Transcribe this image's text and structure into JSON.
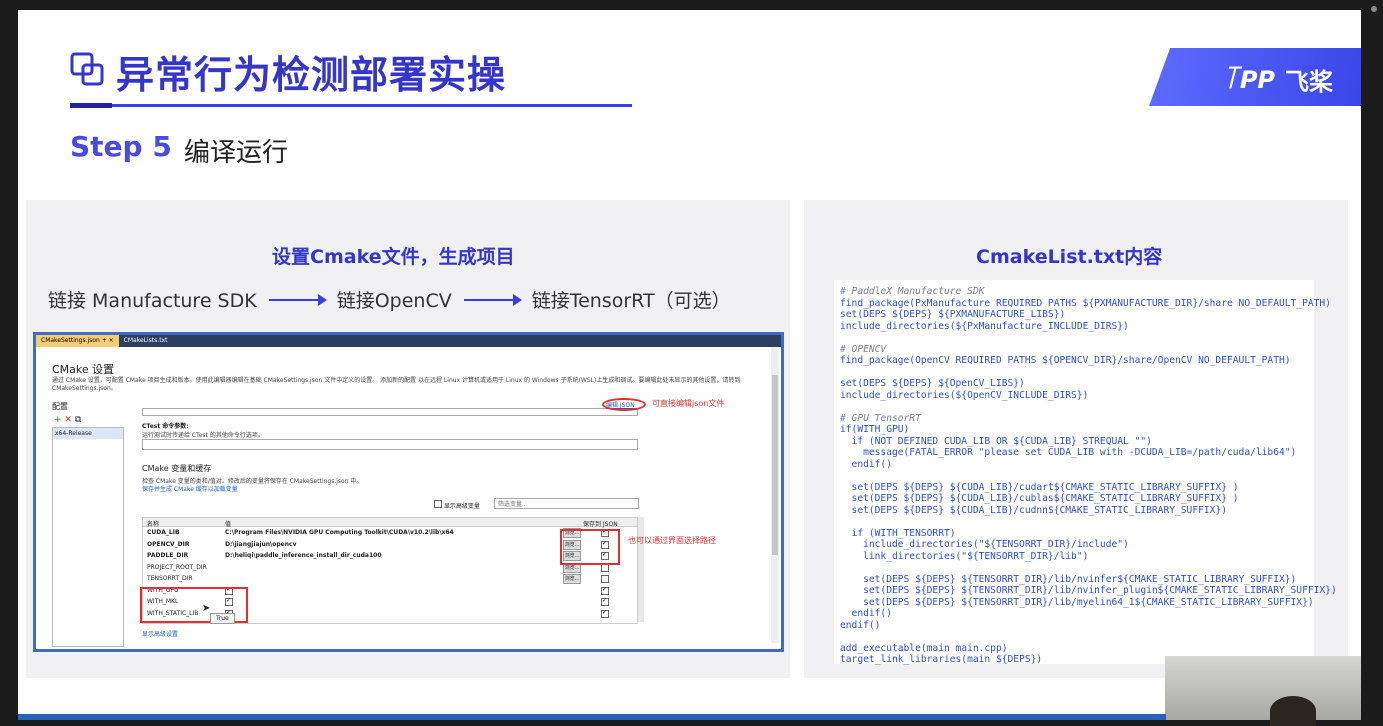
{
  "slide": {
    "title": "异常行为检测部署实操",
    "brand": {
      "logo": "꓄ꓑꓑ",
      "name": "飞桨"
    },
    "step_label": "Step 5",
    "step_desc": "编译运行"
  },
  "left_panel": {
    "title": "设置Cmake文件，生成项目",
    "flow": [
      "链接 Manufacture SDK",
      "链接OpenCV",
      "链接TensorRT（可选）"
    ],
    "vs_window": {
      "tabs": [
        "CMakeSettings.json",
        "CMakeLists.txt"
      ],
      "tab_close": "+ ×",
      "heading": "CMake 设置",
      "description": "通过 CMake 设置，可配置 CMake 项目生成和版本。使用此编辑器编辑在基础 CMakeSettings.json 文件中定义的设置。 添加新的配置 以在远程 Linux 计算机或适用于 Linux 的 Windows 子系统(WSL)上生成和调试。要编辑此处未显示的其他设置，请转到 CMakeSettings.json。",
      "config_label": "配置",
      "config_item": "x64-Release",
      "edit_json": "编辑 JSON",
      "edit_json_note": "可直接编辑json文件",
      "ctest_label": "CTest 命令参数:",
      "ctest_desc": "运行测试时传递给 CTest 的其他命令行选项。",
      "cache_heading": "CMake 变量和缓存",
      "cache_desc": "检查 CMake 变量的类和/值对。修改后的变量将保存在 CMakeSettings.json 中。",
      "cache_link": "保存并生成 CMake 缓存以加载变量",
      "show_advanced": "显示高级变量",
      "filter_placeholder": "筛选变量...",
      "col_name": "名称",
      "col_value": "值",
      "col_save": "保存到 JSON",
      "browse_note": "也可以通过界面选择路径",
      "rows": [
        {
          "name": "CUDA_LIB",
          "value": "C:\\Program Files\\NVIDIA GPU Computing Toolkit\\CUDA\\v10.2\\lib\\x64",
          "bold": true,
          "browse": "浏览...",
          "save": true
        },
        {
          "name": "OPENCV_DIR",
          "value": "D:\\jiangjiajun\\opencv",
          "bold": true,
          "browse": "浏览...",
          "save": true
        },
        {
          "name": "PADDLE_DIR",
          "value": "D:\\heliqi\\paddle_inference_install_dir_cuda100",
          "bold": true,
          "browse": "浏览...",
          "save": true
        },
        {
          "name": "PROJECT_ROOT_DIR",
          "value": "",
          "bold": false,
          "browse": "浏览...",
          "save": false
        },
        {
          "name": "TENSORRT_DIR",
          "value": "",
          "bold": false,
          "browse": "浏览...",
          "save": false
        },
        {
          "name": "WITH_GPU",
          "value": "",
          "bold": false,
          "check": true,
          "save": true
        },
        {
          "name": "WITH_MKL",
          "value": "",
          "bold": false,
          "check": true,
          "save": true
        },
        {
          "name": "WITH_STATIC_LIB",
          "value": "",
          "bold": false,
          "check": true,
          "save": true
        }
      ],
      "tooltip": "True",
      "advanced_link": "显示高级设置"
    }
  },
  "right_panel": {
    "title": "CmakeList.txt内容",
    "code_lines": [
      {
        "t": "# PaddleX Manufacture SDK",
        "c": true
      },
      {
        "t": "find_package(PxManufacture REQUIRED PATHS ${PXMANUFACTURE_DIR}/share NO_DEFAULT_PATH)"
      },
      {
        "t": "set(DEPS ${DEPS} ${PXMANUFACTURE_LIBS})"
      },
      {
        "t": "include_directories(${PxManufacture_INCLUDE_DIRS})"
      },
      {
        "t": ""
      },
      {
        "t": "# OPENCV",
        "c": true
      },
      {
        "t": "find_package(OpenCV REQUIRED PATHS ${OPENCV_DIR}/share/OpenCV NO_DEFAULT_PATH)"
      },
      {
        "t": ""
      },
      {
        "t": "set(DEPS ${DEPS} ${OpenCV_LIBS})"
      },
      {
        "t": "include_directories(${OpenCV_INCLUDE_DIRS})"
      },
      {
        "t": ""
      },
      {
        "t": "# GPU TensorRT",
        "c": true
      },
      {
        "t": "if(WITH_GPU)"
      },
      {
        "t": "  if (NOT DEFINED CUDA_LIB OR ${CUDA_LIB} STREQUAL \"\")"
      },
      {
        "t": "    message(FATAL_ERROR \"please set CUDA_LIB with -DCUDA_LIB=/path/cuda/lib64\")"
      },
      {
        "t": "  endif()"
      },
      {
        "t": ""
      },
      {
        "t": "  set(DEPS ${DEPS} ${CUDA_LIB}/cudart${CMAKE_STATIC_LIBRARY_SUFFIX} )"
      },
      {
        "t": "  set(DEPS ${DEPS} ${CUDA_LIB}/cublas${CMAKE_STATIC_LIBRARY_SUFFIX} )"
      },
      {
        "t": "  set(DEPS ${DEPS} ${CUDA_LIB}/cudnn${CMAKE_STATIC_LIBRARY_SUFFIX})"
      },
      {
        "t": ""
      },
      {
        "t": "  if (WITH_TENSORRT)"
      },
      {
        "t": "    include_directories(\"${TENSORRT_DIR}/include\")"
      },
      {
        "t": "    link_directories(\"${TENSORRT_DIR}/lib\")"
      },
      {
        "t": ""
      },
      {
        "t": "    set(DEPS ${DEPS} ${TENSORRT_DIR}/lib/nvinfer${CMAKE_STATIC_LIBRARY_SUFFIX})"
      },
      {
        "t": "    set(DEPS ${DEPS} ${TENSORRT_DIR}/lib/nvinfer_plugin${CMAKE_STATIC_LIBRARY_SUFFIX})"
      },
      {
        "t": "    set(DEPS ${DEPS} ${TENSORRT_DIR}/lib/myelin64_1${CMAKE_STATIC_LIBRARY_SUFFIX})"
      },
      {
        "t": "  endif()"
      },
      {
        "t": "endif()"
      },
      {
        "t": ""
      },
      {
        "t": "add_executable(main main.cpp)"
      },
      {
        "t": "target_link_libraries(main ${DEPS})"
      }
    ]
  }
}
